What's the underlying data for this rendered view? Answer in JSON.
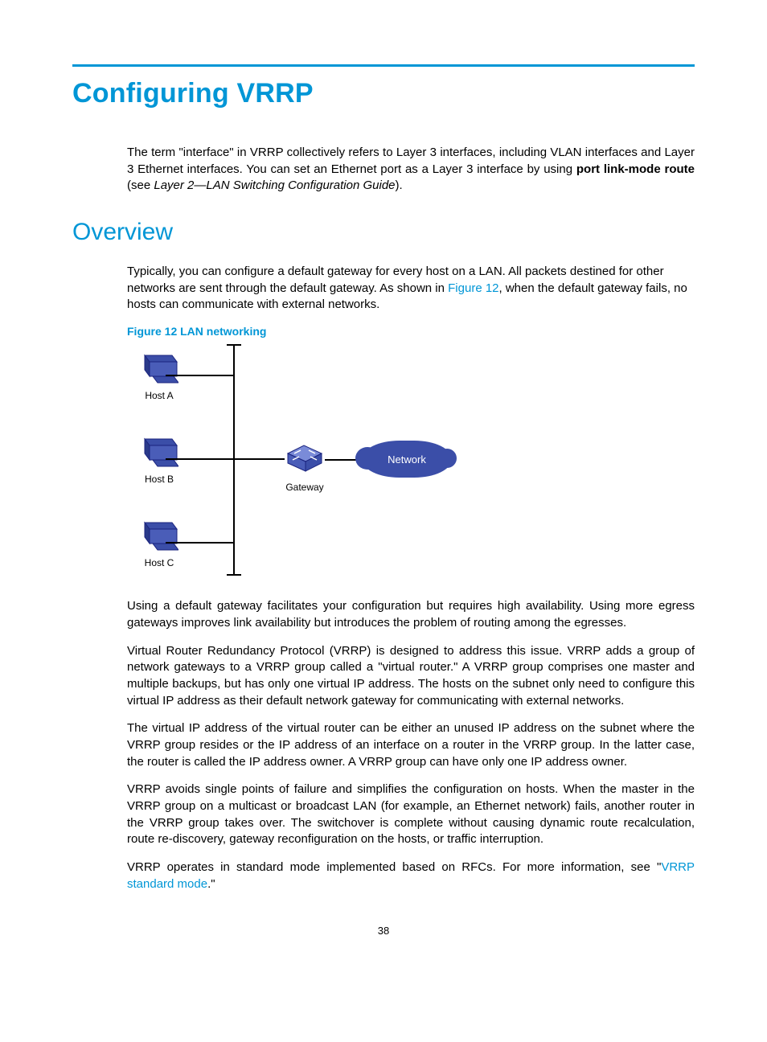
{
  "title": "Configuring VRRP",
  "intro": {
    "pre": "The term \"interface\" in VRRP collectively refers to Layer 3 interfaces, including VLAN interfaces and Layer 3 Ethernet interfaces. You can set an Ethernet port as a Layer 3 interface by using ",
    "bold": "port link-mode route",
    "mid": " (see ",
    "italic": "Layer 2—LAN Switching Configuration Guide",
    "post": ")."
  },
  "section_overview": "Overview",
  "overview_p1": {
    "pre": "Typically, you can configure a default gateway for every host on a LAN. All packets destined for other networks are sent through the default gateway. As shown in ",
    "link": "Figure 12",
    "post": ", when the default gateway fails, no hosts can communicate with external networks."
  },
  "figure_caption": "Figure 12 LAN networking",
  "figure": {
    "host_a": "Host A",
    "host_b": "Host B",
    "host_c": "Host C",
    "gateway": "Gateway",
    "network": "Network"
  },
  "p2": "Using a default gateway facilitates your configuration but requires high availability. Using more egress gateways improves link availability but introduces the problem of routing among the egresses.",
  "p3": "Virtual Router Redundancy Protocol (VRRP) is designed to address this issue. VRRP adds a group of network gateways to a VRRP group called a \"virtual router.\" A VRRP group comprises one master and multiple backups, but has only one virtual IP address. The hosts on the subnet only need to configure this virtual IP address as their default network gateway for communicating with external networks.",
  "p4": "The virtual IP address of the virtual router can be either an unused IP address on the subnet where the VRRP group resides or the IP address of an interface on a router in the VRRP group. In the latter case, the router is called the IP address owner. A VRRP group can have only one IP address owner.",
  "p5": "VRRP avoids single points of failure and simplifies the configuration on hosts. When the master in the VRRP group on a multicast or broadcast LAN (for example, an Ethernet network) fails, another router in the VRRP group takes over. The switchover is complete without causing dynamic route recalculation, route re-discovery, gateway reconfiguration on the hosts, or traffic interruption.",
  "p6": {
    "pre": "VRRP operates in standard mode implemented based on RFCs. For more information, see \"",
    "link": "VRRP standard mode",
    "post": ".\""
  },
  "page_number": "38"
}
